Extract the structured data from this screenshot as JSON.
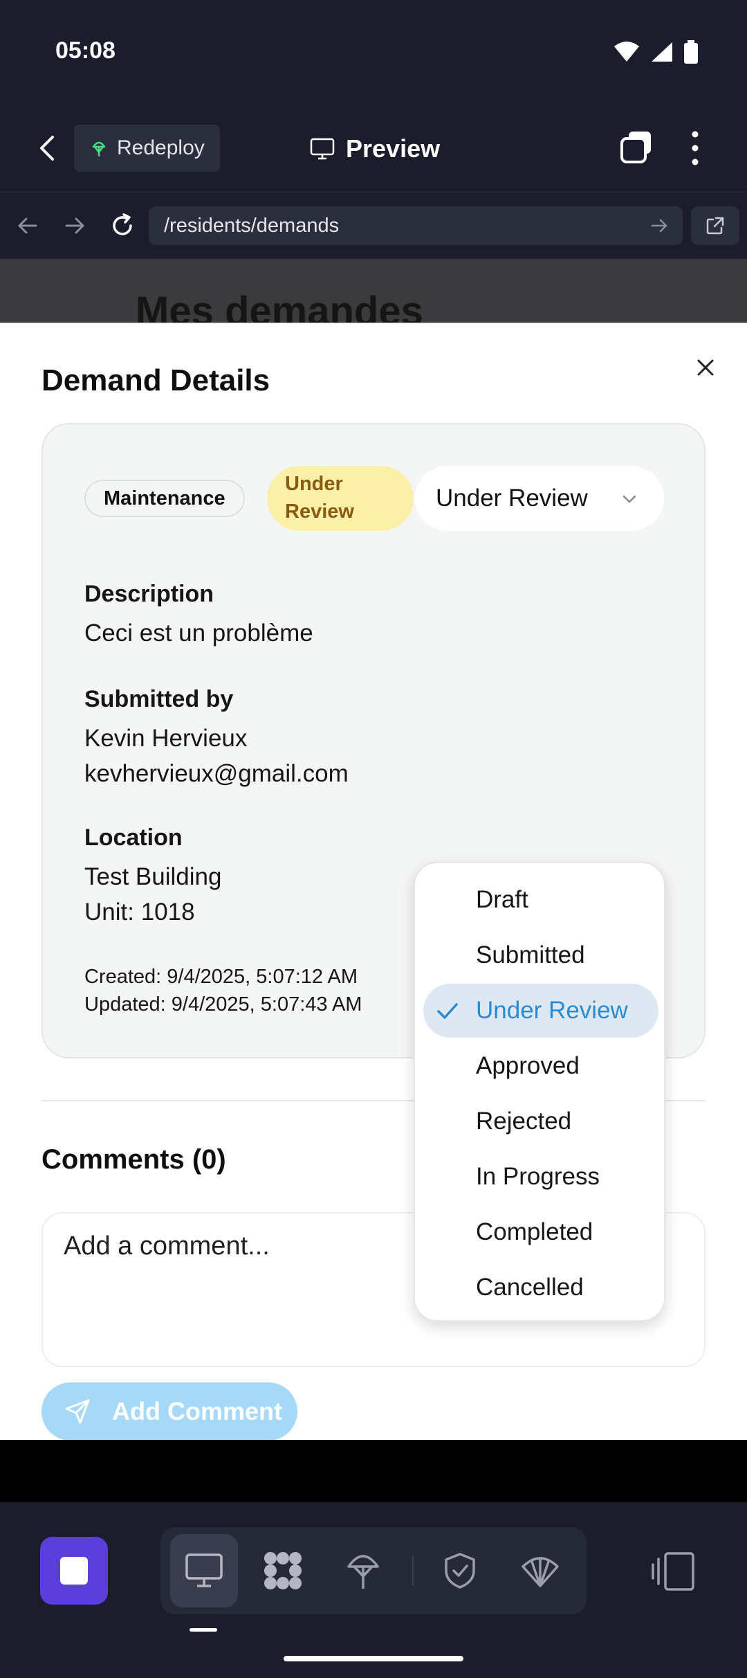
{
  "status_bar": {
    "time": "05:08"
  },
  "header": {
    "redeploy_label": "Redeploy",
    "title": "Preview"
  },
  "browser": {
    "url": "/residents/demands"
  },
  "background_page": {
    "heading": "Mes demandes"
  },
  "modal": {
    "title": "Demand Details",
    "category_badge": "Maintenance",
    "status_badge_line1": "Under",
    "status_badge_line2": "Review",
    "status_select_value": "Under Review",
    "description_label": "Description",
    "description_value": "Ceci est un problème",
    "submitted_by_label": "Submitted by",
    "submitter_name": "Kevin Hervieux",
    "submitter_email": "kevhervieux@gmail.com",
    "location_label": "Location",
    "location_building": "Test Building",
    "location_unit": "Unit: 1018",
    "created": "Created: 9/4/2025, 5:07:12 AM",
    "updated": "Updated: 9/4/2025, 5:07:43 AM",
    "comments_title": "Comments (0)",
    "comment_placeholder": "Add a comment...",
    "add_comment_label": "Add Comment"
  },
  "status_dropdown": {
    "options": [
      "Draft",
      "Submitted",
      "Under Review",
      "Approved",
      "Rejected",
      "In Progress",
      "Completed",
      "Cancelled"
    ],
    "selected": "Under Review"
  },
  "toolbar": {
    "icons": [
      "stop-icon",
      "monitor-icon",
      "grid-dots-icon",
      "deploy-icon",
      "shield-check-icon",
      "shell-icon",
      "device-icon"
    ]
  },
  "colors": {
    "accent": "#2a8bd3",
    "status_badge_bg": "#fbf0a8",
    "status_badge_text": "#8a5a12",
    "stop_button": "#5b3fdb",
    "add_comment_button": "#a6d8f7"
  }
}
